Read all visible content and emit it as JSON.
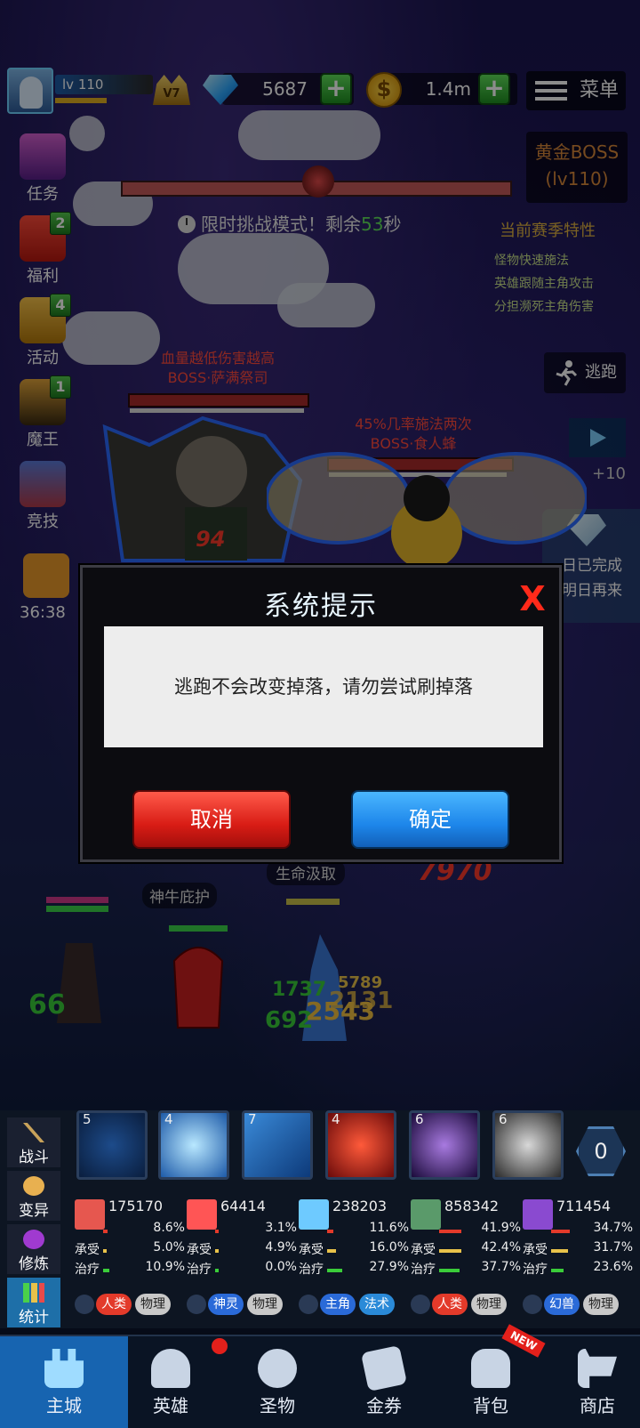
{
  "player": {
    "level_label": "lv 110",
    "vip_label": "V7",
    "gems": "5687",
    "gold": "1.4m"
  },
  "top_menu": {
    "label": "菜单"
  },
  "side_menu": [
    {
      "label": "任务",
      "badge": ""
    },
    {
      "label": "福利",
      "badge": "2"
    },
    {
      "label": "活动",
      "badge": "4"
    },
    {
      "label": "魔王",
      "badge": "1"
    },
    {
      "label": "竞技",
      "badge": ""
    }
  ],
  "side_timer": "36:38",
  "boss_banner": {
    "title": "黄金BOSS",
    "level": "(lv110)"
  },
  "timer": {
    "prefix": "限时挑战模式！剩余",
    "seconds": "53",
    "suffix": "秒"
  },
  "season": {
    "title": "当前赛季特性",
    "items": [
      "怪物快速施法",
      "英雄跟随主角攻击",
      "分担濒死主角伤害"
    ]
  },
  "escape_label": "逃跑",
  "video_bonus": "+10",
  "daily": {
    "line1": "日已完成",
    "line2": "明日再来"
  },
  "enemies": [
    {
      "trait": "血量越低伤害越高",
      "name": "BOSS·萨满祭司",
      "hp_fraction": 0.98
    },
    {
      "trait": "45%几率施法两次",
      "name": "BOSS·食人蜂",
      "hp_fraction": 0.97
    }
  ],
  "battle": {
    "damage_numbers": [
      "94",
      "7970"
    ],
    "skill_banner_1": "神牛庇护",
    "skill_banner_2": "生命汲取",
    "float_numbers": [
      "66",
      "1737",
      "5789",
      "692",
      "2543",
      "2131"
    ]
  },
  "dialog": {
    "title": "系统提示",
    "close_symbol": "X",
    "message": "逃跑不会改变掉落，请勿尝试刷掉落",
    "cancel_label": "取消",
    "confirm_label": "确定"
  },
  "left_tabs": [
    {
      "label": "战斗",
      "active": false
    },
    {
      "label": "变异",
      "active": false
    },
    {
      "label": "修炼",
      "active": false
    },
    {
      "label": "统计",
      "active": true
    }
  ],
  "skills": [
    {
      "count": "5",
      "icon": "ripple-icon"
    },
    {
      "count": "4",
      "icon": "ice-crystal-icon"
    },
    {
      "count": "7",
      "icon": "frost-wind-icon"
    },
    {
      "count": "4",
      "icon": "fire-slash-icon"
    },
    {
      "count": "6",
      "icon": "dark-face-icon"
    },
    {
      "count": "6",
      "icon": "shadow-burst-icon"
    }
  ],
  "skill_counter": "0",
  "stats": [
    {
      "total": "175170",
      "dmg_pct": "8.6%",
      "take_label": "承受",
      "take_pct": "5.0%",
      "heal_label": "治疗",
      "heal_pct": "10.9%",
      "tags": [
        "人类",
        "物理"
      ],
      "color": "#e6574f"
    },
    {
      "total": "64414",
      "dmg_pct": "3.1%",
      "take_label": "承受",
      "take_pct": "4.9%",
      "heal_label": "治疗",
      "heal_pct": "0.0%",
      "tags": [
        "神灵",
        "物理"
      ],
      "color": "#ff5555"
    },
    {
      "total": "238203",
      "dmg_pct": "11.6%",
      "take_label": "承受",
      "take_pct": "16.0%",
      "heal_label": "治疗",
      "heal_pct": "27.9%",
      "tags": [
        "主角",
        "法术"
      ],
      "color": "#6ecaff"
    },
    {
      "total": "858342",
      "dmg_pct": "41.9%",
      "take_label": "承受",
      "take_pct": "42.4%",
      "heal_label": "治疗",
      "heal_pct": "37.7%",
      "tags": [
        "人类",
        "物理"
      ],
      "color": "#5a9a6a"
    },
    {
      "total": "711454",
      "dmg_pct": "34.7%",
      "take_label": "承受",
      "take_pct": "31.7%",
      "heal_label": "治疗",
      "heal_pct": "23.6%",
      "tags": [
        "幻兽",
        "物理"
      ],
      "color": "#8a4ad0"
    }
  ],
  "nav": [
    {
      "label": "主城",
      "active": true
    },
    {
      "label": "英雄",
      "active": false
    },
    {
      "label": "圣物",
      "active": false
    },
    {
      "label": "金券",
      "active": false
    },
    {
      "label": "背包",
      "active": false
    },
    {
      "label": "商店",
      "active": false
    }
  ],
  "nav_new_badge": "NEW"
}
